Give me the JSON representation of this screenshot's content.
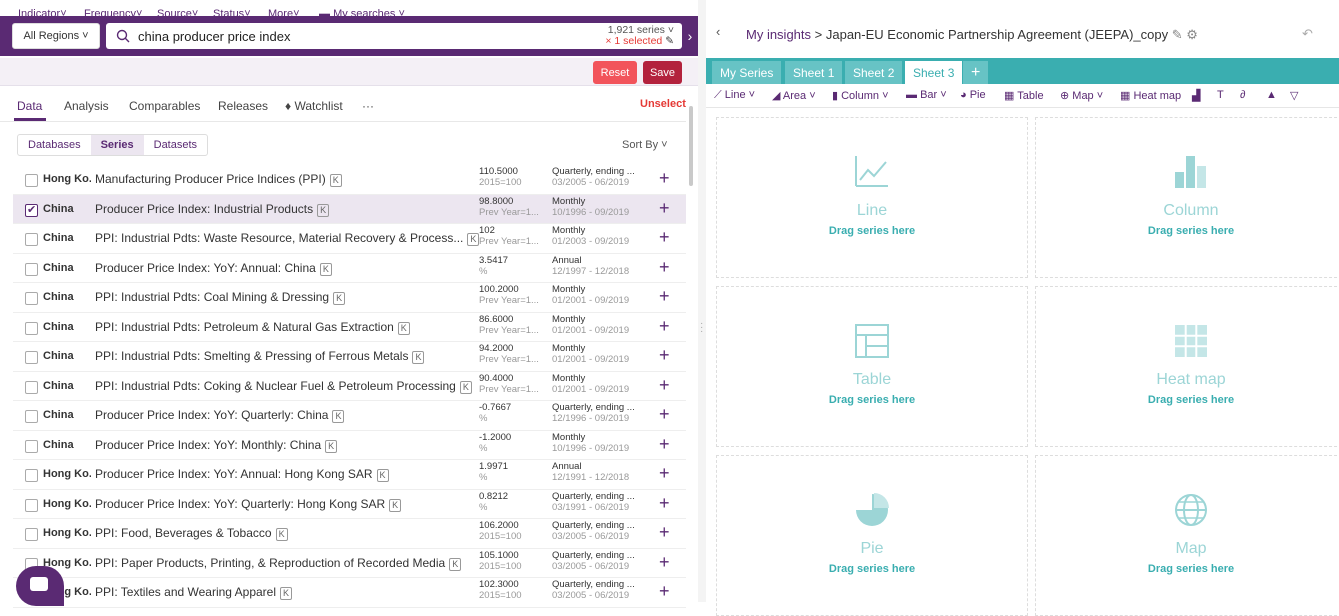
{
  "search": {
    "region": "All Regions",
    "query": "china producer price index",
    "series_count": "1,921 series",
    "selected": "1 selected"
  },
  "filters": {
    "indicator": "Indicator",
    "frequency": "Frequency",
    "source": "Source",
    "status": "Status",
    "more": "More",
    "my_searches": "My searches",
    "reset": "Reset",
    "save": "Save"
  },
  "tabs": {
    "data": "Data",
    "analysis": "Analysis",
    "comparables": "Comparables",
    "releases": "Releases",
    "watchlist": "Watchlist",
    "more": "···",
    "unselect": "Unselect"
  },
  "segments": {
    "databases": "Databases",
    "series": "Series",
    "datasets": "Datasets",
    "sort": "Sort By"
  },
  "rows": [
    {
      "region": "Hong Ko...",
      "name": "Manufacturing Producer Price Indices (PPI)",
      "k": "K",
      "value": "110.5000",
      "unit": "2015=100",
      "freq": "Quarterly, ending ...",
      "range": "03/2005 - 06/2019",
      "selected": false
    },
    {
      "region": "China",
      "name": "Producer Price Index: Industrial Products",
      "k": "K",
      "value": "98.8000",
      "unit": "Prev Year=1...",
      "freq": "Monthly",
      "range": "10/1996 - 09/2019",
      "selected": true
    },
    {
      "region": "China",
      "name": "PPI: Industrial Pdts: Waste Resource, Material Recovery & Process...",
      "k": "K",
      "value": "102",
      "unit": "Prev Year=1...",
      "freq": "Monthly",
      "range": "01/2003 - 09/2019",
      "selected": false
    },
    {
      "region": "China",
      "name": "Producer Price Index: YoY: Annual: China",
      "k": "K",
      "value": "3.5417",
      "unit": "%",
      "freq": "Annual",
      "range": "12/1997 - 12/2018",
      "selected": false
    },
    {
      "region": "China",
      "name": "PPI: Industrial Pdts: Coal Mining & Dressing",
      "k": "K",
      "value": "100.2000",
      "unit": "Prev Year=1...",
      "freq": "Monthly",
      "range": "01/2001 - 09/2019",
      "selected": false
    },
    {
      "region": "China",
      "name": "PPI: Industrial Pdts: Petroleum & Natural Gas Extraction",
      "k": "K",
      "value": "86.6000",
      "unit": "Prev Year=1...",
      "freq": "Monthly",
      "range": "01/2001 - 09/2019",
      "selected": false
    },
    {
      "region": "China",
      "name": "PPI: Industrial Pdts: Smelting & Pressing of Ferrous Metals",
      "k": "K",
      "value": "94.2000",
      "unit": "Prev Year=1...",
      "freq": "Monthly",
      "range": "01/2001 - 09/2019",
      "selected": false
    },
    {
      "region": "China",
      "name": "PPI: Industrial Pdts: Coking & Nuclear Fuel & Petroleum Processing",
      "k": "K",
      "value": "90.4000",
      "unit": "Prev Year=1...",
      "freq": "Monthly",
      "range": "01/2001 - 09/2019",
      "selected": false
    },
    {
      "region": "China",
      "name": "Producer Price Index: YoY: Quarterly: China",
      "k": "K",
      "value": "-0.7667",
      "unit": "%",
      "freq": "Quarterly, ending ...",
      "range": "12/1996 - 09/2019",
      "selected": false
    },
    {
      "region": "China",
      "name": "Producer Price Index: YoY: Monthly: China",
      "k": "K",
      "value": "-1.2000",
      "unit": "%",
      "freq": "Monthly",
      "range": "10/1996 - 09/2019",
      "selected": false
    },
    {
      "region": "Hong Ko...",
      "name": "Producer Price Index: YoY: Annual: Hong Kong SAR",
      "k": "K",
      "value": "1.9971",
      "unit": "%",
      "freq": "Annual",
      "range": "12/1991 - 12/2018",
      "selected": false
    },
    {
      "region": "Hong Ko...",
      "name": "Producer Price Index: YoY: Quarterly: Hong Kong SAR",
      "k": "K",
      "value": "0.8212",
      "unit": "%",
      "freq": "Quarterly, ending ...",
      "range": "03/1991 - 06/2019",
      "selected": false
    },
    {
      "region": "Hong Ko...",
      "name": "PPI: Food, Beverages & Tobacco",
      "k": "K",
      "value": "106.2000",
      "unit": "2015=100",
      "freq": "Quarterly, ending ...",
      "range": "03/2005 - 06/2019",
      "selected": false
    },
    {
      "region": "Hong Ko...",
      "name": "PPI: Paper Products, Printing, & Reproduction of Recorded Media",
      "k": "K",
      "value": "105.1000",
      "unit": "2015=100",
      "freq": "Quarterly, ending ...",
      "range": "03/2005 - 06/2019",
      "selected": false
    },
    {
      "region": "Hong Ko...",
      "name": "PPI: Textiles and Wearing Apparel",
      "k": "K",
      "value": "102.3000",
      "unit": "2015=100",
      "freq": "Quarterly, ending ...",
      "range": "03/2005 - 06/2019",
      "selected": false
    }
  ],
  "insight": {
    "root": "My insights",
    "title": "Japan-EU Economic Partnership Agreement (JEEPA)_copy"
  },
  "sheets": [
    "My Series",
    "Sheet 1",
    "Sheet 2",
    "Sheet 3"
  ],
  "toolbar": {
    "line": "Line",
    "area": "Area",
    "column": "Column",
    "bar": "Bar",
    "pie": "Pie",
    "table": "Table",
    "map": "Map",
    "heatmap": "Heat map"
  },
  "cells": [
    {
      "title": "Line",
      "drag": "Drag series here"
    },
    {
      "title": "Column",
      "drag": "Drag series here"
    },
    {
      "title": "Table",
      "drag": "Drag series here"
    },
    {
      "title": "Heat map",
      "drag": "Drag series here"
    },
    {
      "title": "Pie",
      "drag": "Drag series here"
    },
    {
      "title": "Map",
      "drag": "Drag series here"
    }
  ],
  "colors": {
    "purple": "#5a2a73",
    "teal": "#3aaeb0",
    "red": "#f2545b",
    "darkred": "#b3223d"
  }
}
